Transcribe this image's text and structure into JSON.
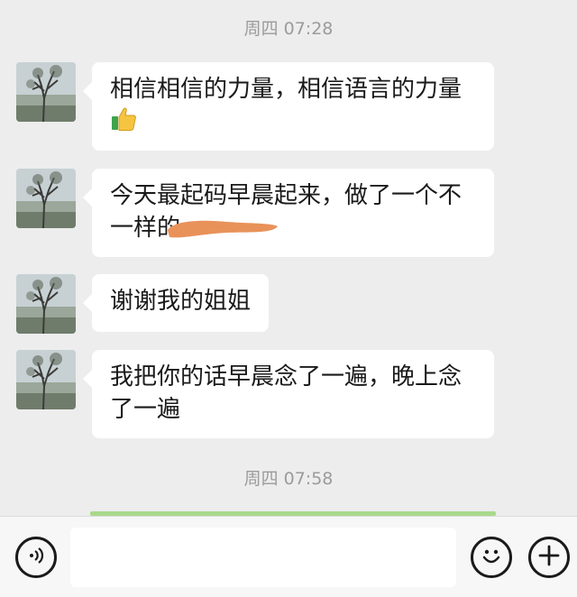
{
  "chat": {
    "timestamps": [
      "周四 07:28",
      "周四 07:58"
    ],
    "messages": [
      {
        "lines": [
          "相信相信的力量，相信语言的力量"
        ],
        "emoji": "thumbs-up"
      },
      {
        "lines": [
          "今天最起码早晨起来，做了一个不",
          "一样的"
        ],
        "redacted": true
      },
      {
        "lines": [
          "谢谢我的姐姐"
        ]
      },
      {
        "lines": [
          "我把你的话早晨念了一遍，晚上念",
          "了一遍"
        ]
      }
    ]
  },
  "input_bar": {
    "icons": [
      "voice-icon",
      "emoji-icon",
      "plus-icon"
    ],
    "text_value": ""
  },
  "colors": {
    "background": "#ededed",
    "bubble": "#ffffff",
    "timestamp": "#9b9b9b",
    "redaction": "#e8925a"
  }
}
